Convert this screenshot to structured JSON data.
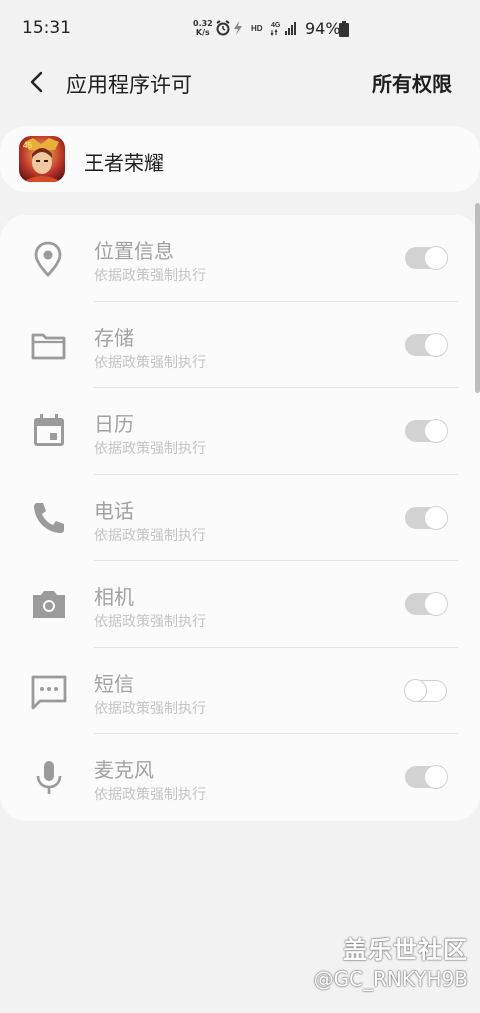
{
  "status_bar": {
    "time": "15:31",
    "net_speed_value": "0.32",
    "net_speed_unit": "K/s",
    "hd_label": "HD",
    "network_label": "4G",
    "battery": "94%"
  },
  "header": {
    "back_icon": "chevron-left-icon",
    "title": "应用程序许可",
    "action": "所有权限"
  },
  "app": {
    "name": "王者荣耀",
    "icon": "app-icon"
  },
  "permissions": [
    {
      "label": "位置信息",
      "sub": "依据政策强制执行",
      "icon": "location-pin-icon",
      "enabled": true
    },
    {
      "label": "存储",
      "sub": "依据政策强制执行",
      "icon": "folder-icon",
      "enabled": true
    },
    {
      "label": "日历",
      "sub": "依据政策强制执行",
      "icon": "calendar-icon",
      "enabled": true
    },
    {
      "label": "电话",
      "sub": "依据政策强制执行",
      "icon": "phone-icon",
      "enabled": true
    },
    {
      "label": "相机",
      "sub": "依据政策强制执行",
      "icon": "camera-icon",
      "enabled": true
    },
    {
      "label": "短信",
      "sub": "依据政策强制执行",
      "icon": "message-icon",
      "enabled": false
    },
    {
      "label": "麦克风",
      "sub": "依据政策强制执行",
      "icon": "microphone-icon",
      "enabled": true
    }
  ],
  "watermark": {
    "brand": "盖乐世社区",
    "user": "@GC_RNKYH9B"
  },
  "colors": {
    "background": "#f2f2f2",
    "card": "#fbfbfb",
    "disabled_text": "#a2a2a2",
    "toggle_disabled": "#d2d2d2"
  }
}
